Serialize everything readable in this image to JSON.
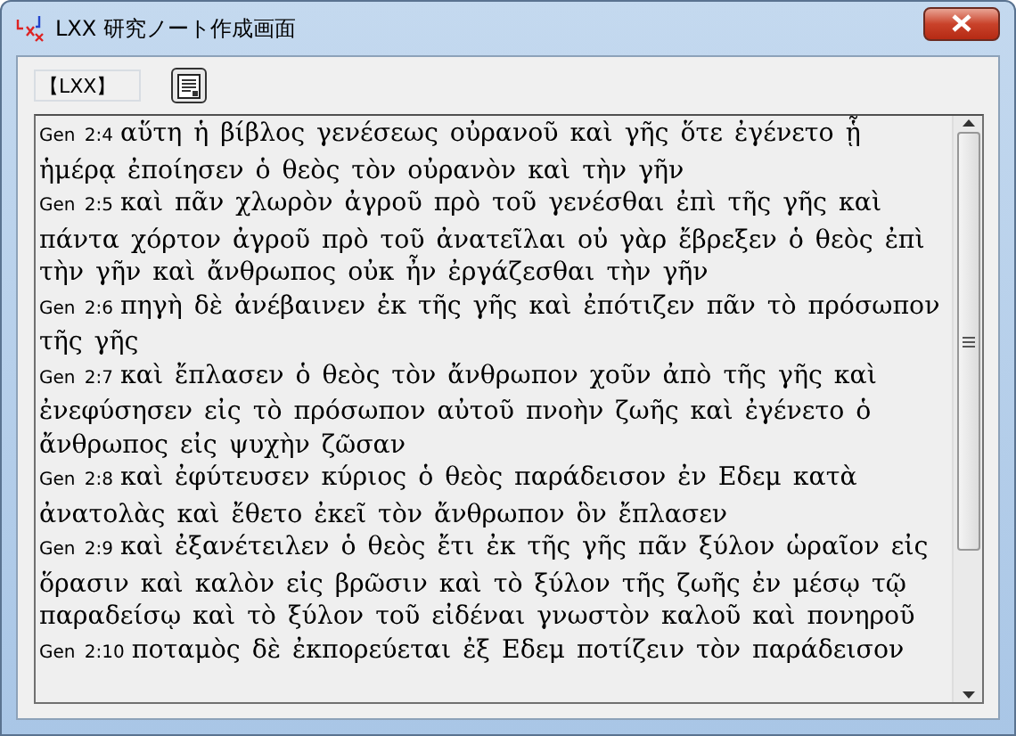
{
  "window": {
    "title": "LXX 研究ノート作成画面"
  },
  "toolbar": {
    "field_value": "【LXX】"
  },
  "verses": [
    {
      "ref": "Gen 2:4",
      "text": "αὕτη ἡ βίβλος γενέσεως οὐρανοῦ καὶ γῆς ὅτε ἐγένετο ᾗ ἡμέρᾳ ἐποίησεν ὁ θεὸς τὸν οὐρανὸν καὶ τὴν γῆν"
    },
    {
      "ref": "Gen 2:5",
      "text": "καὶ πᾶν χλωρὸν ἀγροῦ πρὸ τοῦ γενέσθαι ἐπὶ τῆς γῆς καὶ πάντα χόρτον ἀγροῦ πρὸ τοῦ ἀνατεῖλαι οὐ γὰρ ἔβρεξεν ὁ θεὸς ἐπὶ τὴν γῆν καὶ ἄνθρωπος οὐκ ἦν ἐργάζεσθαι τὴν γῆν"
    },
    {
      "ref": "Gen 2:6",
      "text": "πηγὴ δὲ ἀνέβαινεν ἐκ τῆς γῆς καὶ ἐπότιζεν πᾶν τὸ πρόσωπον τῆς γῆς"
    },
    {
      "ref": "Gen 2:7",
      "text": "καὶ ἔπλασεν ὁ θεὸς τὸν ἄνθρωπον χοῦν ἀπὸ τῆς γῆς καὶ ἐνεφύσησεν εἰς τὸ πρόσωπον αὐτοῦ πνοὴν ζωῆς καὶ ἐγένετο ὁ ἄνθρωπος εἰς ψυχὴν ζῶσαν"
    },
    {
      "ref": "Gen 2:8",
      "text": "καὶ ἐφύτευσεν κύριος ὁ θεὸς παράδεισον ἐν Εδεμ κατὰ ἀνατολὰς καὶ ἔθετο ἐκεῖ τὸν ἄνθρωπον ὃν ἔπλασεν"
    },
    {
      "ref": "Gen 2:9",
      "text": "καὶ ἐξανέτειλεν ὁ θεὸς ἔτι ἐκ τῆς γῆς πᾶν ξύλον ὡραῖον εἰς ὅρασιν καὶ καλὸν εἰς βρῶσιν καὶ τὸ ξύλον τῆς ζωῆς ἐν μέσῳ τῷ παραδείσῳ καὶ τὸ ξύλον τοῦ εἰδέναι γνωστὸν καλοῦ καὶ πονηροῦ"
    },
    {
      "ref": "Gen 2:10",
      "text": "ποταμὸς δὲ ἐκπορεύεται ἐξ Εδεμ ποτίζειν τὸν παράδεισον"
    }
  ]
}
